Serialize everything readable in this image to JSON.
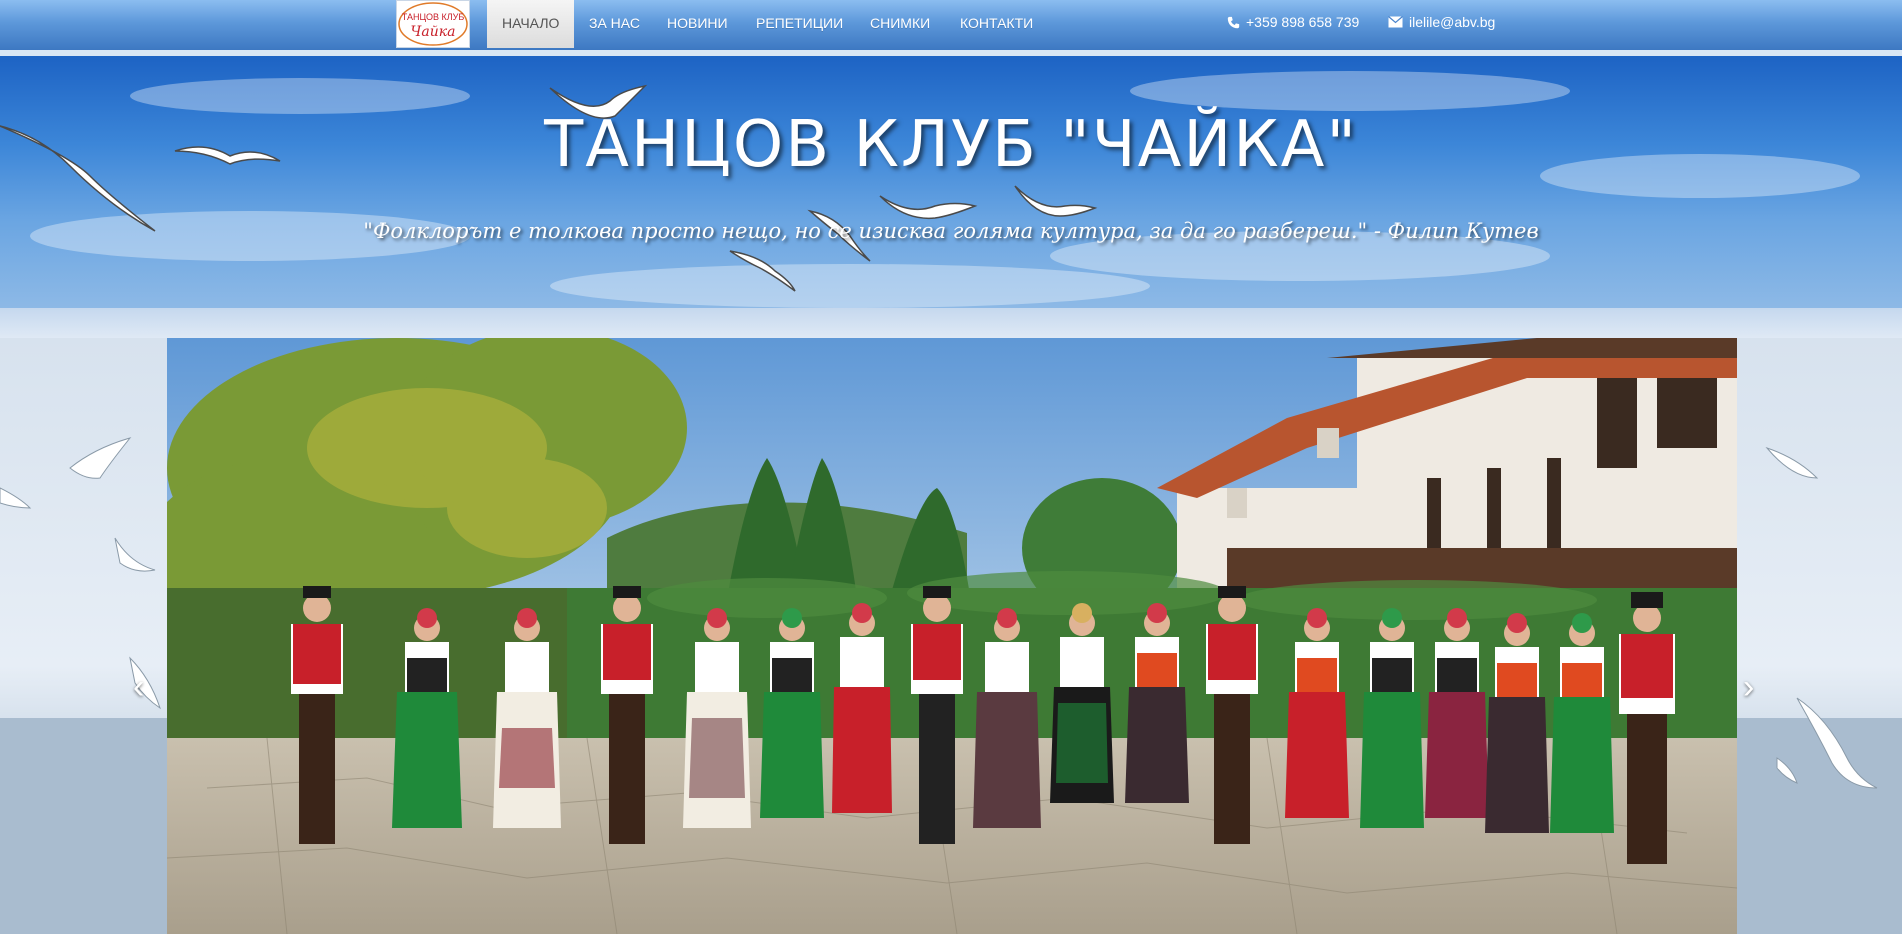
{
  "logo": {
    "line1": "ТАНЦОВ КЛУБ",
    "line2": "Чайка"
  },
  "nav": {
    "items": [
      {
        "label": "НАЧАЛО",
        "active": true
      },
      {
        "label": "ЗА НАС"
      },
      {
        "label": "НОВИНИ"
      },
      {
        "label": "РЕПЕТИЦИИ"
      },
      {
        "label": "СНИМКИ"
      },
      {
        "label": "КОНТАКТИ"
      }
    ],
    "phone": "+359 898 658 739",
    "email": "ilelile@abv.bg",
    "icons": {
      "phone": "phone-icon",
      "email": "envelope-icon"
    }
  },
  "header": {
    "title": "ТАНЦОВ КЛУБ \"ЧАЙКА\"",
    "quote": "\"Фолклорът е толкова просто нещо, но се изисква голяма култура, за да го разбереш.\" - Филип Кутев"
  },
  "carousel": {
    "prev_icon": "chevron-left-icon",
    "next_icon": "chevron-right-icon",
    "prev_symbol": "‹",
    "next_symbol": "›"
  },
  "colors": {
    "nav_top": "#8bbdf0",
    "nav_bottom": "#3d78c2",
    "sky": "#3c86d8",
    "costume_red": "#c8202a",
    "costume_green": "#1f8a3a"
  }
}
